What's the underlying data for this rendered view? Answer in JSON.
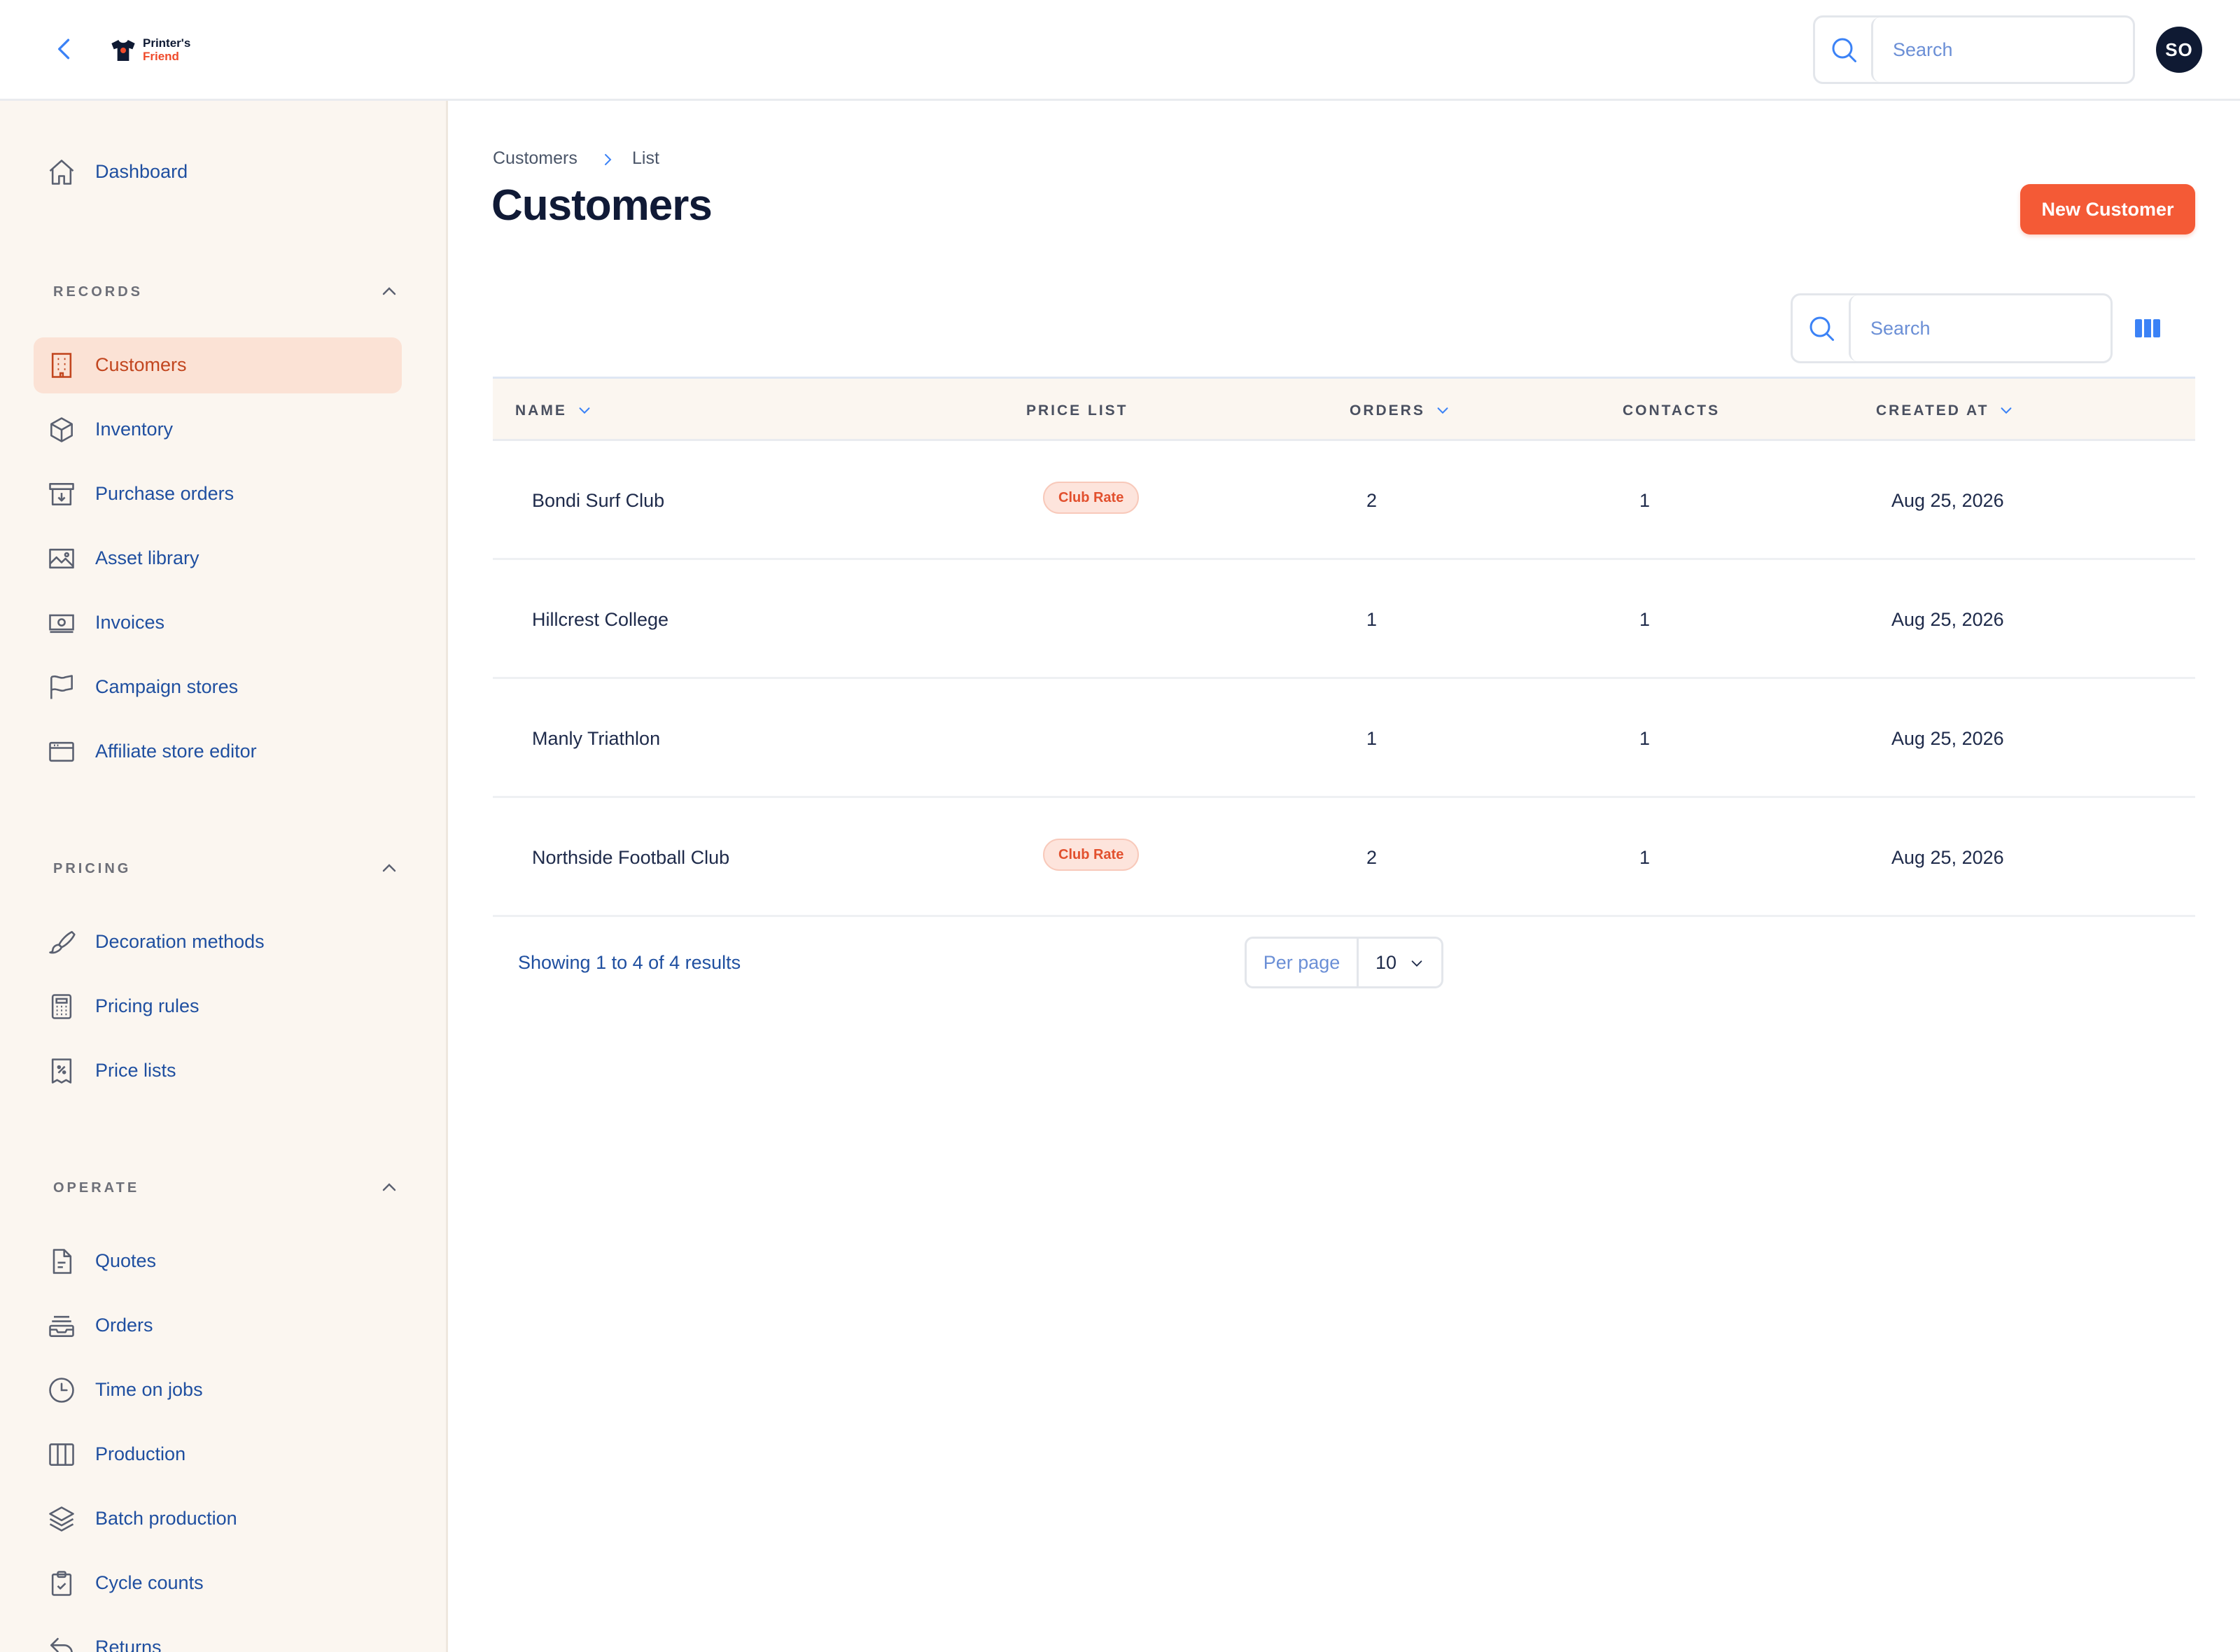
{
  "app": {
    "logo_line1": "Printer's",
    "logo_line2": "Friend",
    "search_placeholder": "Search",
    "avatar_initials": "SO"
  },
  "sidebar": {
    "dashboard": "Dashboard",
    "sections": {
      "records": "RECORDS",
      "pricing": "PRICING",
      "operate": "OPERATE"
    },
    "records": [
      {
        "label": "Customers",
        "icon": "building-icon",
        "active": true
      },
      {
        "label": "Inventory",
        "icon": "box-icon"
      },
      {
        "label": "Purchase orders",
        "icon": "archive-download-icon"
      },
      {
        "label": "Asset library",
        "icon": "image-icon"
      },
      {
        "label": "Invoices",
        "icon": "banknote-icon"
      },
      {
        "label": "Campaign stores",
        "icon": "flag-icon"
      },
      {
        "label": "Affiliate store editor",
        "icon": "browser-window-icon"
      }
    ],
    "pricing": [
      {
        "label": "Decoration methods",
        "icon": "paintbrush-icon"
      },
      {
        "label": "Pricing rules",
        "icon": "calculator-icon"
      },
      {
        "label": "Price lists",
        "icon": "receipt-percent-icon"
      }
    ],
    "operate": [
      {
        "label": "Quotes",
        "icon": "document-icon"
      },
      {
        "label": "Orders",
        "icon": "inbox-stack-icon"
      },
      {
        "label": "Time on jobs",
        "icon": "clock-icon"
      },
      {
        "label": "Production",
        "icon": "columns-icon"
      },
      {
        "label": "Batch production",
        "icon": "layers-icon"
      },
      {
        "label": "Cycle counts",
        "icon": "clipboard-check-icon"
      },
      {
        "label": "Returns",
        "icon": "return-arrow-icon"
      }
    ]
  },
  "main": {
    "breadcrumb": [
      "Customers",
      "List"
    ],
    "title": "Customers",
    "new_button": "New Customer",
    "table_search_placeholder": "Search",
    "columns": [
      "NAME",
      "PRICE LIST",
      "ORDERS",
      "CONTACTS",
      "CREATED AT"
    ],
    "rows": [
      {
        "name": "Bondi Surf Club",
        "price_list": "Club Rate",
        "orders": "2",
        "contacts": "1",
        "created_at": "Aug 25, 2026"
      },
      {
        "name": "Hillcrest College",
        "price_list": "",
        "orders": "1",
        "contacts": "1",
        "created_at": "Aug 25, 2026"
      },
      {
        "name": "Manly Triathlon",
        "price_list": "",
        "orders": "1",
        "contacts": "1",
        "created_at": "Aug 25, 2026"
      },
      {
        "name": "Northside Football Club",
        "price_list": "Club Rate",
        "orders": "2",
        "contacts": "1",
        "created_at": "Aug 25, 2026"
      }
    ],
    "showing": "Showing 1 to 4 of 4 results",
    "per_page_label": "Per page",
    "per_page_value": "10"
  },
  "colors": {
    "accent": "#f45a36",
    "nav_text": "#1f4fa0",
    "sidebar_bg": "#fbf6f0",
    "active_bg": "#fbe2d5"
  }
}
